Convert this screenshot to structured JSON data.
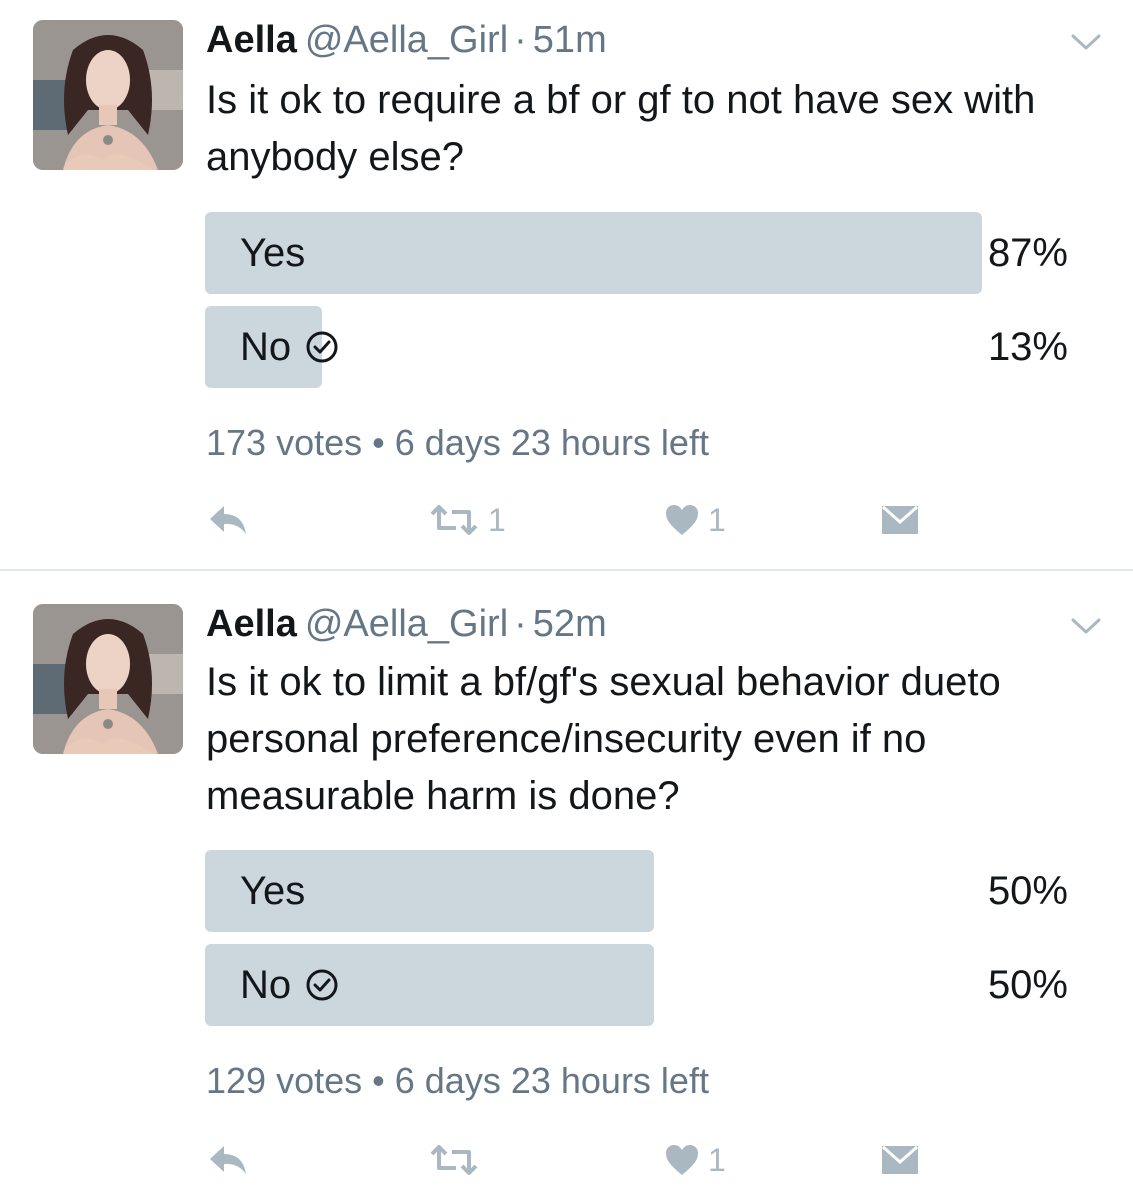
{
  "tweets": [
    {
      "name": "Aella",
      "handle": "@Aella_Girl",
      "separator": "·",
      "time": "51m",
      "text": "Is it ok to require a bf or gf to not have sex with anybody else?",
      "poll": {
        "options": [
          {
            "label": "Yes",
            "percent": "87%",
            "fill": 0.9,
            "chosen": false
          },
          {
            "label": "No",
            "percent": "13%",
            "fill": 0.135,
            "chosen": true
          }
        ],
        "votes": "173 votes",
        "bullet": "•",
        "time_left": "6 days 23 hours left"
      },
      "actions": {
        "reply": "",
        "retweet_count": "1",
        "like_count": "1",
        "dm": ""
      }
    },
    {
      "name": "Aella",
      "handle": "@Aella_Girl",
      "separator": "·",
      "time": "52m",
      "text": "Is it ok to limit a bf/gf's sexual behavior dueto personal preference/insecurity even if no measurable harm is done?",
      "poll": {
        "options": [
          {
            "label": "Yes",
            "percent": "50%",
            "fill": 0.52,
            "chosen": false
          },
          {
            "label": "No",
            "percent": "50%",
            "fill": 0.52,
            "chosen": true
          }
        ],
        "votes": "129 votes",
        "bullet": "•",
        "time_left": "6 days 23 hours left"
      },
      "actions": {
        "reply": "",
        "retweet_count": "",
        "like_count": "1",
        "dm": ""
      }
    }
  ],
  "colors": {
    "bar": "#ccd6dd",
    "muted_text": "#657786",
    "icon": "#aab8c2",
    "divider": "#e1e8ed"
  },
  "icons": [
    "reply-icon",
    "retweet-icon",
    "heart-icon",
    "dm-icon",
    "checkmark-icon",
    "caret-down-icon"
  ]
}
